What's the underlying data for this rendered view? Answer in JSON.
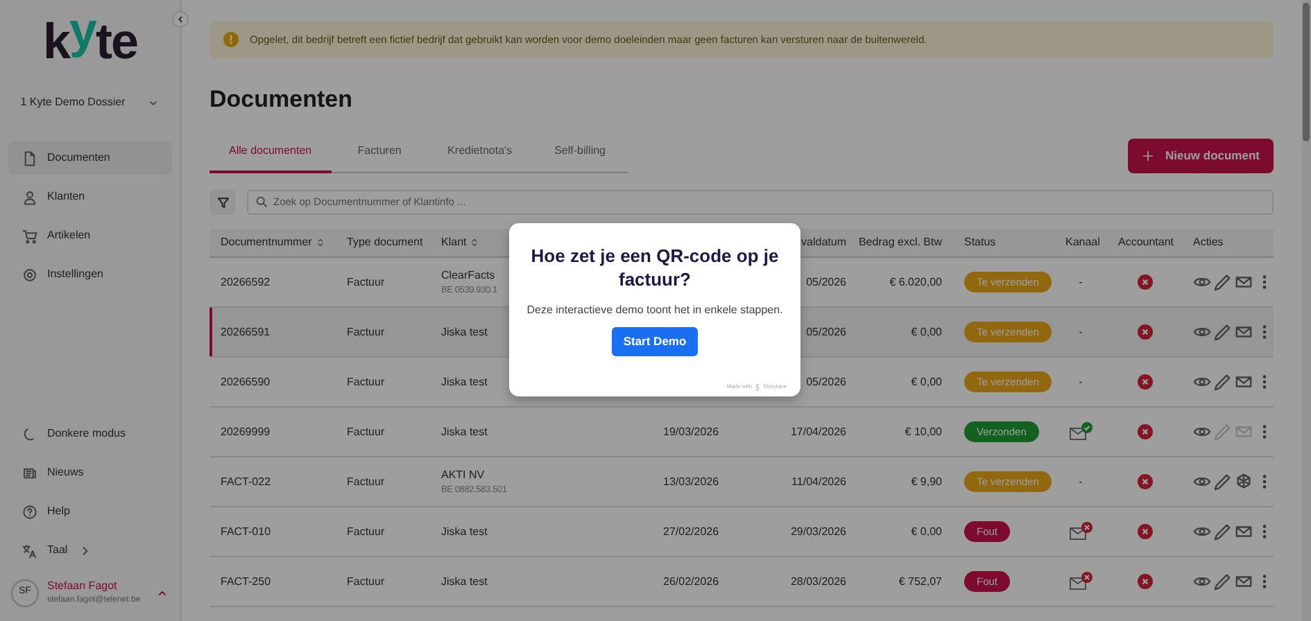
{
  "sidebar": {
    "logo": [
      {
        "text": "k",
        "accent": false
      },
      {
        "text": "y",
        "accent": true
      },
      {
        "text": "te",
        "accent": false
      }
    ],
    "dossier": "1 Kyte Demo Dossier",
    "nav": [
      {
        "label": "Documenten",
        "selected": true
      },
      {
        "label": "Klanten",
        "selected": false
      },
      {
        "label": "Artikelen",
        "selected": false
      },
      {
        "label": "Instellingen",
        "selected": false
      }
    ],
    "bottom": [
      {
        "label": "Donkere modus",
        "submenu": false
      },
      {
        "label": "Nieuws",
        "submenu": false
      },
      {
        "label": "Help",
        "submenu": false
      },
      {
        "label": "Taal",
        "submenu": true
      }
    ],
    "user": {
      "initials": "SF",
      "name": "Stefaan Fagot",
      "email": "stefaan.fagot@telenet.be"
    }
  },
  "alert": "Opgelet, dit bedrijf betreft een fictief bedrijf dat gebruikt kan worden voor demo doeleinden maar geen facturen kan versturen naar de buitenwereld.",
  "title": "Documenten",
  "tabs": [
    {
      "label": "Alle documenten",
      "selected": true
    },
    {
      "label": "Facturen",
      "selected": false
    },
    {
      "label": "Kredietnota's",
      "selected": false
    },
    {
      "label": "Self-billing",
      "selected": false
    }
  ],
  "new_button": "Nieuw document",
  "search": {
    "placeholder": "Zoek op Documentnummer of Klantinfo ..."
  },
  "table": {
    "columns": [
      {
        "label": "Documentnummer",
        "sortable": true
      },
      {
        "label": "Type document",
        "sortable": false
      },
      {
        "label": "Klant",
        "sortable": true
      },
      {
        "label": "valdatum",
        "sortable": false
      },
      {
        "label": "Bedrag excl. Btw",
        "sortable": false
      },
      {
        "label": "Status",
        "sortable": false
      },
      {
        "label": "Kanaal",
        "sortable": false
      },
      {
        "label": "Accountant",
        "sortable": false
      },
      {
        "label": "Acties",
        "sortable": false
      }
    ],
    "rows": [
      {
        "number": "20266592",
        "type": "Factuur",
        "client": "ClearFacts",
        "client_vat": "BE 0539.930.1",
        "due_date": "05/2026",
        "amount": "€ 6.020,00",
        "status": {
          "label": "Te verzenden",
          "kind": "pending"
        },
        "channel": {
          "kind": "text",
          "text": "-"
        },
        "accountant_synced": false,
        "send_action": {
          "kind": "mail"
        },
        "actions_disabled": false,
        "selected": false
      },
      {
        "number": "20266591",
        "type": "Factuur",
        "client": "Jiska test",
        "due_date": "05/2026",
        "amount": "€ 0,00",
        "status": {
          "label": "Te verzenden",
          "kind": "pending"
        },
        "channel": {
          "kind": "text",
          "text": "-"
        },
        "accountant_synced": false,
        "send_action": {
          "kind": "mail"
        },
        "actions_disabled": false,
        "selected": true
      },
      {
        "number": "20266590",
        "type": "Factuur",
        "client": "Jiska test",
        "due_date": "05/2026",
        "amount": "€ 0,00",
        "status": {
          "label": "Te verzenden",
          "kind": "pending"
        },
        "channel": {
          "kind": "text",
          "text": "-"
        },
        "accountant_synced": false,
        "send_action": {
          "kind": "mail"
        },
        "actions_disabled": false,
        "selected": false
      },
      {
        "number": "20269999",
        "type": "Factuur",
        "client": "Jiska test",
        "date": "19/03/2026",
        "due_date": "17/04/2026",
        "amount": "€ 10,00",
        "status": {
          "label": "Verzonden",
          "kind": "sent"
        },
        "channel": {
          "kind": "sent"
        },
        "accountant_synced": false,
        "send_action": {
          "kind": "mail"
        },
        "actions_disabled": true,
        "selected": false
      },
      {
        "number": "FACT-022",
        "type": "Factuur",
        "client": "AKTI NV",
        "client_vat": "BE 0882.583.501",
        "date": "13/03/2026",
        "due_date": "11/04/2026",
        "amount": "€ 9,90",
        "status": {
          "label": "Te verzenden",
          "kind": "pending"
        },
        "channel": {
          "kind": "text",
          "text": "-"
        },
        "accountant_synced": false,
        "send_action": {
          "kind": "network"
        },
        "actions_disabled": false,
        "selected": false
      },
      {
        "number": "FACT-010",
        "type": "Factuur",
        "client": "Jiska test",
        "date": "27/02/2026",
        "due_date": "29/03/2026",
        "amount": "€ 0,00",
        "status": {
          "label": "Fout",
          "kind": "error"
        },
        "channel": {
          "kind": "failed"
        },
        "accountant_synced": false,
        "send_action": {
          "kind": "mail"
        },
        "actions_disabled": false,
        "selected": false
      },
      {
        "number": "FACT-250",
        "type": "Factuur",
        "client": "Jiska test",
        "date": "26/02/2026",
        "due_date": "28/03/2026",
        "amount": "€ 752,07",
        "status": {
          "label": "Fout",
          "kind": "error"
        },
        "channel": {
          "kind": "failed"
        },
        "accountant_synced": false,
        "send_action": {
          "kind": "mail"
        },
        "actions_disabled": false,
        "selected": false
      }
    ]
  },
  "modal": {
    "title": "Hoe zet je een QR-code op je factuur?",
    "text": "Deze interactieve demo toont het in enkele stappen.",
    "button": "Start Demo",
    "credit": "Made with",
    "brand": "Storylane"
  }
}
